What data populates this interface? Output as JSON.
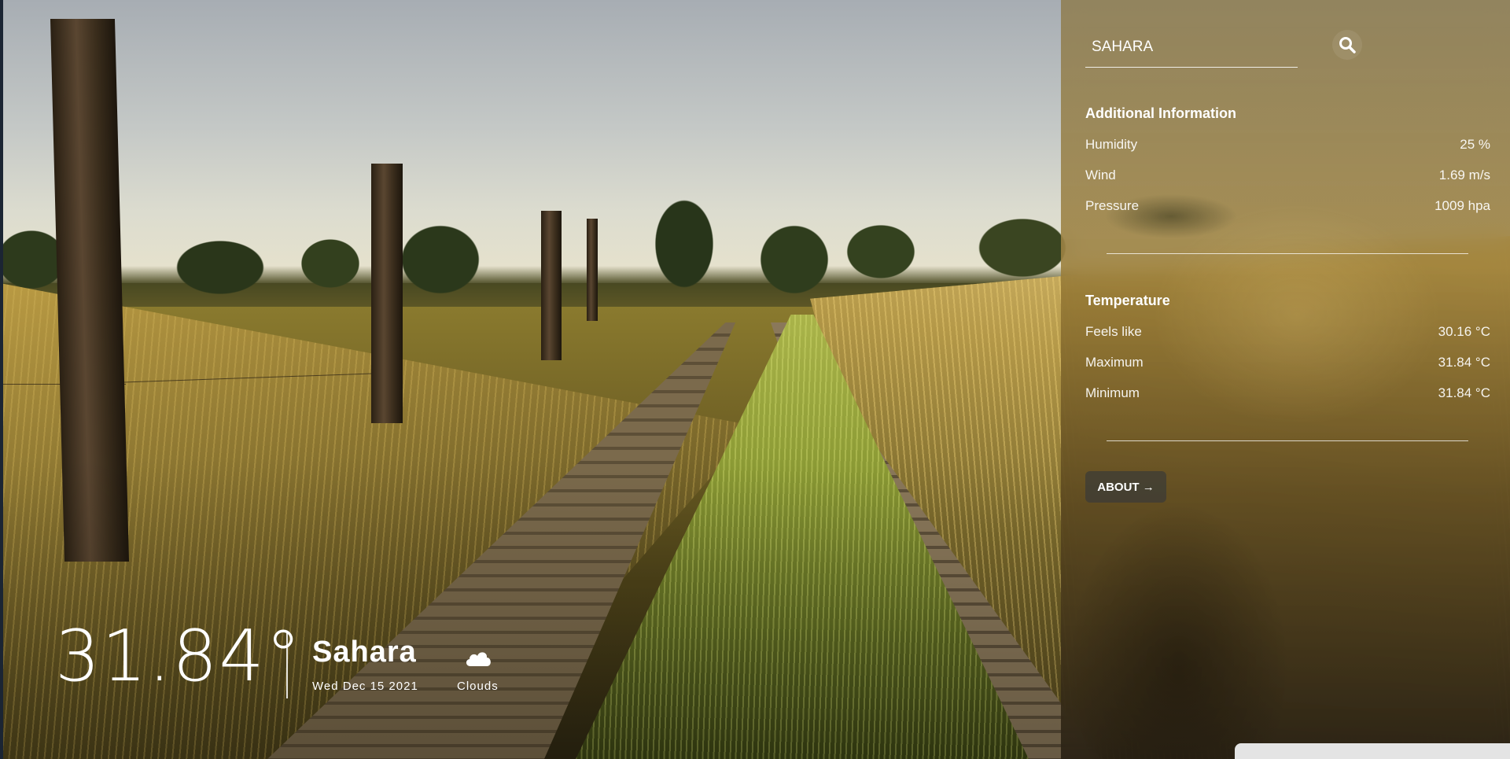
{
  "search": {
    "value": "SAHARA",
    "placeholder": "Another location",
    "button_icon": "search-icon"
  },
  "additional_info": {
    "title": "Additional Information",
    "rows": [
      {
        "label": "Humidity",
        "value": "25 %"
      },
      {
        "label": "Wind",
        "value": "1.69 m/s"
      },
      {
        "label": "Pressure",
        "value": "1009 hpa"
      }
    ]
  },
  "temperature": {
    "title": "Temperature",
    "rows": [
      {
        "label": "Feels like",
        "value": "30.16 °C"
      },
      {
        "label": "Maximum",
        "value": "31.84 °C"
      },
      {
        "label": "Minimum",
        "value": "31.84 °C"
      }
    ]
  },
  "about_button": {
    "label": "ABOUT →"
  },
  "current": {
    "temperature": "31.84°",
    "city": "Sahara",
    "date": "Wed Dec 15 2021",
    "condition": "Clouds",
    "condition_icon": "cloud-icon"
  },
  "colors": {
    "text": "#ffffff",
    "button_bg": "#3c3c37"
  }
}
